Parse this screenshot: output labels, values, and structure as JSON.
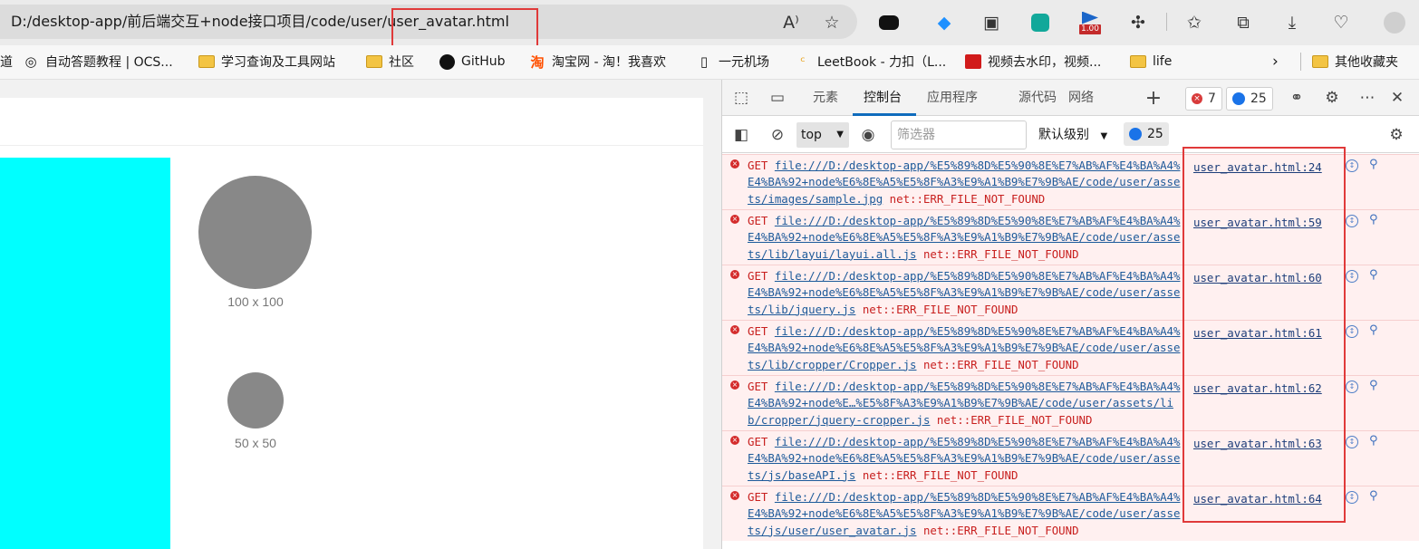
{
  "address_bar": {
    "url": "D:/desktop-app/前后端交互+node接口项目/code/user/user_avatar.html"
  },
  "toolbar": {
    "extension_badge": "1.00"
  },
  "bookmarks": [
    {
      "label": "自动答题教程 | OCS...",
      "icon": "ocs-icon"
    },
    {
      "label": "学习查询及工具网站",
      "icon": "folder-icon"
    },
    {
      "label": "社区",
      "icon": "folder-icon"
    },
    {
      "label": "GitHub",
      "icon": "github-icon"
    },
    {
      "label": "淘宝网 - 淘！我喜欢",
      "icon": "taobao-icon"
    },
    {
      "label": "一元机场",
      "icon": "page-icon"
    },
    {
      "label": "LeetBook - 力扣（L...",
      "icon": "leetcode-icon"
    },
    {
      "label": "视频去水印，视频...",
      "icon": "video-icon"
    },
    {
      "label": "life",
      "icon": "folder-icon"
    }
  ],
  "bookmarks_other": "其他收藏夹",
  "bookmarks_cut": "道",
  "page": {
    "preview_large": "100 x 100",
    "preview_small": "50 x 50"
  },
  "devtools": {
    "tabs": [
      "元素",
      "控制台",
      "应用程序",
      "源代码",
      "网络"
    ],
    "active_tab": "控制台",
    "error_count": "7",
    "message_count": "25",
    "context": "top",
    "filter_placeholder": "筛选器",
    "levels": "默认级别",
    "toolbar_message_count": "25",
    "entries": [
      {
        "method": "GET",
        "url": "file:///D:/desktop-app/%E5%89%8D%E5%90%8E%E7%AB%AF%E4%BA%A4%E4%BA%92+node%E6%8E%A5%E5%8F%A3%E9%A1%B9%E7%9B%AE/code/user/assets/images/sample.jpg",
        "error": "net::ERR_FILE_NOT_FOUND",
        "source": "user_avatar.html:24"
      },
      {
        "method": "GET",
        "url": "file:///D:/desktop-app/%E5%89%8D%E5%90%8E%E7%AB%AF%E4%BA%A4%E4%BA%92+node%E6%8E%A5%E5%8F%A3%E9%A1%B9%E7%9B%AE/code/user/assets/lib/layui/layui.all.js",
        "error": "net::ERR_FILE_NOT_FOUND",
        "source": "user_avatar.html:59"
      },
      {
        "method": "GET",
        "url": "file:///D:/desktop-app/%E5%89%8D%E5%90%8E%E7%AB%AF%E4%BA%A4%E4%BA%92+node%E6%8E%A5%E5%8F%A3%E9%A1%B9%E7%9B%AE/code/user/assets/lib/jquery.js",
        "error": "net::ERR_FILE_NOT_FOUND",
        "source": "user_avatar.html:60"
      },
      {
        "method": "GET",
        "url": "file:///D:/desktop-app/%E5%89%8D%E5%90%8E%E7%AB%AF%E4%BA%A4%E4%BA%92+node%E6%8E%A5%E5%8F%A3%E9%A1%B9%E7%9B%AE/code/user/assets/lib/cropper/Cropper.js",
        "error": "net::ERR_FILE_NOT_FOUND",
        "source": "user_avatar.html:61"
      },
      {
        "method": "GET",
        "url": "file:///D:/desktop-app/%E5%89%8D%E5%90%8E%E7%AB%AF%E4%BA%A4%E4%BA%92+node%E…%E5%8F%A3%E9%A1%B9%E7%9B%AE/code/user/assets/lib/cropper/jquery-cropper.js",
        "error": "net::ERR_FILE_NOT_FOUND",
        "source": "user_avatar.html:62"
      },
      {
        "method": "GET",
        "url": "file:///D:/desktop-app/%E5%89%8D%E5%90%8E%E7%AB%AF%E4%BA%A4%E4%BA%92+node%E6%8E%A5%E5%8F%A3%E9%A1%B9%E7%9B%AE/code/user/assets/js/baseAPI.js",
        "error": "net::ERR_FILE_NOT_FOUND",
        "source": "user_avatar.html:63"
      },
      {
        "method": "GET",
        "url": "file:///D:/desktop-app/%E5%89%8D%E5%90%8E%E7%AB%AF%E4%BA%A4%E4%BA%92+node%E6%8E%A5%E5%8F%A3%E9%A1%B9%E7%9B%AE/code/user/assets/js/user/user_avatar.js",
        "error": "net::ERR_FILE_NOT_FOUND",
        "source": "user_avatar.html:64"
      }
    ]
  },
  "colors": {
    "highlight": "#e03a3a",
    "accent": "#0f6cbd",
    "error_text": "#c8201f",
    "placeholder_cyan": "#00ffff",
    "preview_gray": "#888888"
  }
}
